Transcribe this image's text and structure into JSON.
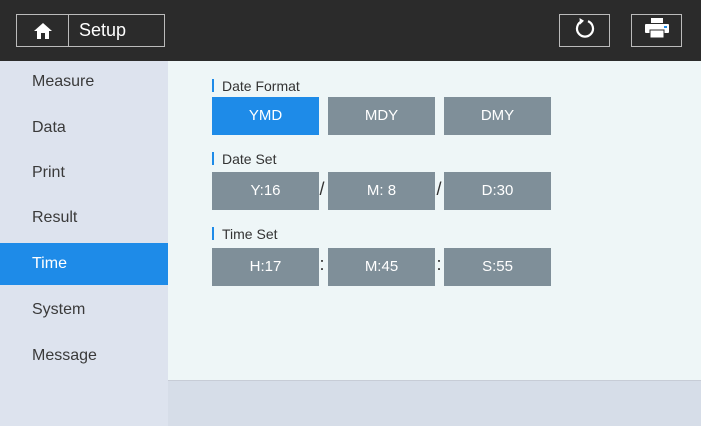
{
  "header": {
    "title": "Setup",
    "home_icon": "home-icon",
    "refresh_icon": "refresh-icon",
    "print_icon": "printer-icon"
  },
  "sidebar": {
    "items": [
      {
        "label": "Measure"
      },
      {
        "label": "Data"
      },
      {
        "label": "Print"
      },
      {
        "label": "Result"
      },
      {
        "label": "Time",
        "active": true
      },
      {
        "label": "System"
      },
      {
        "label": "Message"
      }
    ]
  },
  "main": {
    "date_format": {
      "label": "Date Format",
      "options": [
        {
          "label": "YMD",
          "selected": true
        },
        {
          "label": "MDY"
        },
        {
          "label": "DMY"
        }
      ]
    },
    "date_set": {
      "label": "Date Set",
      "year": "Y:16",
      "month": "M: 8",
      "day": "D:30",
      "separator": "/"
    },
    "time_set": {
      "label": "Time Set",
      "hour": "H:17",
      "minute": "M:45",
      "second": "S:55",
      "separator": ":"
    }
  },
  "colors": {
    "accent": "#1e8be8",
    "button_inactive": "#7f8f99",
    "header_bg": "#2b2b2b",
    "sidebar_bg": "#dde3ee",
    "content_bg": "#eef6f7"
  }
}
